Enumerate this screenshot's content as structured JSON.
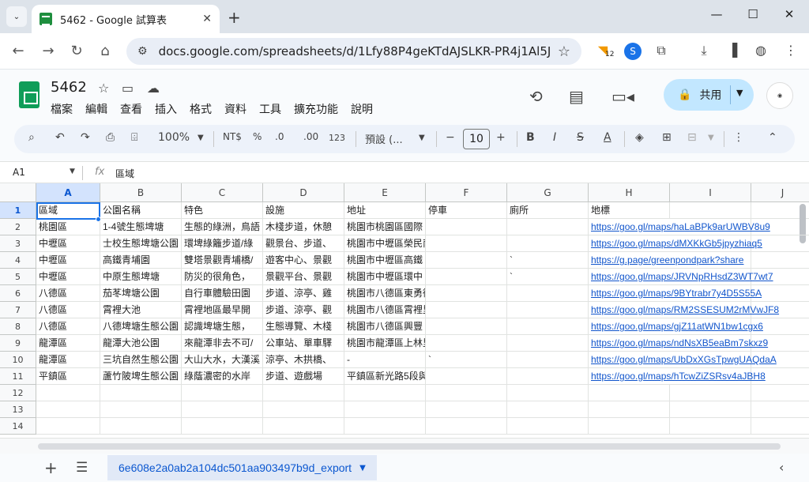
{
  "browser": {
    "tab_title": "5462 - Google 試算表",
    "tab_close": "✕",
    "new_tab": "+",
    "url": "docs.google.com/spreadsheets/d/1Lfy88P4geKTdAJSLKR-PR4j1Al5J1Aqi...",
    "ext_badge": "12"
  },
  "sheets": {
    "doc_title": "5462",
    "menu": [
      "檔案",
      "編輯",
      "查看",
      "插入",
      "格式",
      "資料",
      "工具",
      "擴充功能",
      "說明"
    ],
    "share_label": "共用"
  },
  "toolbar": {
    "zoom": "100%",
    "currency": "NT$",
    "percent": "%",
    "decrease_decimal": ".0",
    "increase_decimal": ".00",
    "number_format": "123",
    "font": "預設 (...",
    "font_size": "10"
  },
  "formula_bar": {
    "name_box": "A1",
    "fx": "fx",
    "value": "區域"
  },
  "grid": {
    "columns": [
      "A",
      "B",
      "C",
      "D",
      "E",
      "F",
      "G",
      "H",
      "I",
      "J"
    ],
    "row_numbers": [
      "1",
      "2",
      "3",
      "4",
      "5",
      "6",
      "7",
      "8",
      "9",
      "10",
      "11",
      "12",
      "13",
      "14"
    ],
    "rows": [
      [
        "區域",
        "公園名稱",
        "特色",
        "設施",
        "地址",
        "停車",
        "廁所",
        "地標"
      ],
      [
        "桃園區",
        "1-4號生態埤塘",
        "生態的綠洲，鳥語",
        "木棧步道，休憩",
        "桃園市桃園區國際",
        "",
        "",
        "https://goo.gl/maps/haLaBPk9arUWBV8u9"
      ],
      [
        "中壢區",
        "士校生態埤塘公園",
        "環埤綠籬步道/綠",
        "觀景台、步道、",
        "桃園市中壢區榮民南路與同慶路口",
        "",
        "",
        "https://goo.gl/maps/dMXKkGb5jpyzhiaq5"
      ],
      [
        "中壢區",
        "高鐵青埔園",
        "雙塔景觀青埔橋/",
        "遊客中心、景觀",
        "桃園市中壢區高鐵",
        "",
        "`",
        "https://g.page/greenpondpark?share"
      ],
      [
        "中壢區",
        "中原生態埤塘",
        "防災的很角色，",
        "景觀平台、景觀",
        "桃園市中壢區環中",
        "",
        "`",
        "https://goo.gl/maps/JRVNpRHsdZ3WT7wt7"
      ],
      [
        "八德區",
        "茄苳埤塘公園",
        "自行車體驗田園",
        "步道、涼亭、雞",
        "桃園市八德區東勇街",
        "",
        "",
        "https://goo.gl/maps/9BYtrabr7y4D5S55A"
      ],
      [
        "八德區",
        "霄裡大池",
        "霄裡地區最早開",
        "步道、涼亭、觀",
        "桃園市八德區霄裡里淨覺街185巷(霄裡池)",
        "",
        "",
        "https://goo.gl/maps/RM2SSESUM2rMVwJF8"
      ],
      [
        "八德區",
        "八德埤塘生態公園",
        "認識埤塘生態，",
        "生態導覽、木棧",
        "桃園市八德區興豐",
        "",
        "",
        "https://goo.gl/maps/gjZ11atWN1bw1cgx6"
      ],
      [
        "龍潭區",
        "龍潭大池公園",
        "來龍潭非去不可/",
        "公車站、單車驛",
        "桃園市龍潭區上林里中豐路上林段",
        "",
        "",
        "https://goo.gl/maps/ndNsXB5eaBm7skxz9"
      ],
      [
        "龍潭區",
        "三坑自然生態公園",
        "大山大水，大漢溪",
        "涼亭、木拱橋、",
        "-",
        "`",
        "",
        "https://goo.gl/maps/UbDxXGsTpwgUAQdaA"
      ],
      [
        "平鎮區",
        "蘆竹陂埤生態公園",
        "綠蔭濃密的水岸",
        "步道、遊戲場",
        "平鎮區新光路5段與天津街交叉口",
        "",
        "",
        "https://goo.gl/maps/hTcwZiZSRsv4aJBH8"
      ],
      [
        "",
        "",
        "",
        "",
        "",
        "",
        "",
        ""
      ],
      [
        "",
        "",
        "",
        "",
        "",
        "",
        "",
        ""
      ],
      [
        "",
        "",
        "",
        "",
        "",
        "",
        "",
        ""
      ]
    ]
  },
  "sheet_tabs": {
    "active": "6e608e2a0ab2a104dc501aa903497b9d_export"
  }
}
